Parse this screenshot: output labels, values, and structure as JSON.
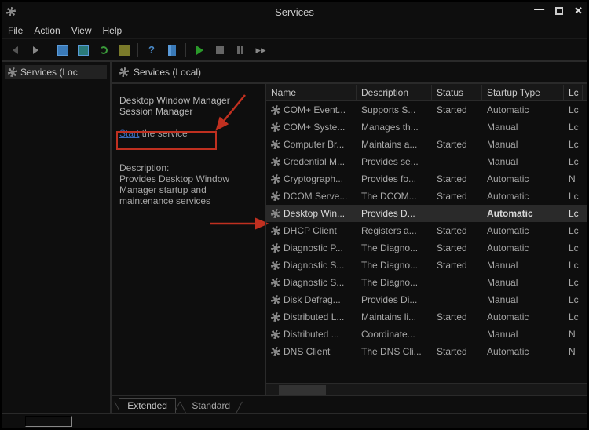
{
  "window": {
    "title": "Services"
  },
  "menubar": {
    "file": "File",
    "action": "Action",
    "view": "View",
    "help": "Help"
  },
  "tree": {
    "root_label": "Services (Loc"
  },
  "right_header": "Services (Local)",
  "detail": {
    "service_name": "Desktop Window Manager Session Manager",
    "start_label": "Start",
    "start_suffix": " the service",
    "desc_heading": "Description:",
    "desc_body": "Provides Desktop Window Manager startup and maintenance services"
  },
  "columns": {
    "name": "Name",
    "description": "Description",
    "status": "Status",
    "startup": "Startup Type",
    "logon": "Lc"
  },
  "services": [
    {
      "name": "COM+ Event...",
      "desc": "Supports S...",
      "status": "Started",
      "startup": "Automatic",
      "logon": "Lc",
      "selected": false
    },
    {
      "name": "COM+ Syste...",
      "desc": "Manages th...",
      "status": "",
      "startup": "Manual",
      "logon": "Lc",
      "selected": false
    },
    {
      "name": "Computer Br...",
      "desc": "Maintains a...",
      "status": "Started",
      "startup": "Manual",
      "logon": "Lc",
      "selected": false
    },
    {
      "name": "Credential M...",
      "desc": "Provides se...",
      "status": "",
      "startup": "Manual",
      "logon": "Lc",
      "selected": false
    },
    {
      "name": "Cryptograph...",
      "desc": "Provides fo...",
      "status": "Started",
      "startup": "Automatic",
      "logon": "N",
      "selected": false
    },
    {
      "name": "DCOM Serve...",
      "desc": "The DCOM...",
      "status": "Started",
      "startup": "Automatic",
      "logon": "Lc",
      "selected": false
    },
    {
      "name": "Desktop Win...",
      "desc": "Provides D...",
      "status": "",
      "startup": "Automatic",
      "logon": "Lc",
      "selected": true
    },
    {
      "name": "DHCP Client",
      "desc": "Registers a...",
      "status": "Started",
      "startup": "Automatic",
      "logon": "Lc",
      "selected": false
    },
    {
      "name": "Diagnostic P...",
      "desc": "The Diagno...",
      "status": "Started",
      "startup": "Automatic",
      "logon": "Lc",
      "selected": false
    },
    {
      "name": "Diagnostic S...",
      "desc": "The Diagno...",
      "status": "Started",
      "startup": "Manual",
      "logon": "Lc",
      "selected": false
    },
    {
      "name": "Diagnostic S...",
      "desc": "The Diagno...",
      "status": "",
      "startup": "Manual",
      "logon": "Lc",
      "selected": false
    },
    {
      "name": "Disk Defrag...",
      "desc": "Provides Di...",
      "status": "",
      "startup": "Manual",
      "logon": "Lc",
      "selected": false
    },
    {
      "name": "Distributed L...",
      "desc": "Maintains li...",
      "status": "Started",
      "startup": "Automatic",
      "logon": "Lc",
      "selected": false
    },
    {
      "name": "Distributed ...",
      "desc": "Coordinate...",
      "status": "",
      "startup": "Manual",
      "logon": "N",
      "selected": false
    },
    {
      "name": "DNS Client",
      "desc": "The DNS Cli...",
      "status": "Started",
      "startup": "Automatic",
      "logon": "N",
      "selected": false
    }
  ],
  "tabs": {
    "extended": "Extended",
    "standard": "Standard"
  }
}
